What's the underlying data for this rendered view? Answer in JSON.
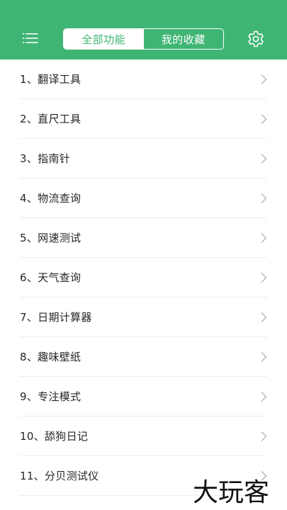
{
  "header": {
    "background": "#3fb574",
    "menu_icon": "list-menu-icon",
    "settings_icon": "gear-icon",
    "tabs": [
      {
        "label": "全部功能",
        "active": true
      },
      {
        "label": "我的收藏",
        "active": false
      }
    ]
  },
  "list": {
    "items": [
      {
        "label": "1、翻译工具"
      },
      {
        "label": "2、直尺工具"
      },
      {
        "label": "3、指南针"
      },
      {
        "label": "4、物流查询"
      },
      {
        "label": "5、网速测试"
      },
      {
        "label": "6、天气查询"
      },
      {
        "label": "7、日期计算器"
      },
      {
        "label": "8、趣味壁纸"
      },
      {
        "label": "9、专注模式"
      },
      {
        "label": "10、舔狗日记"
      },
      {
        "label": "11、分贝测试仪"
      }
    ],
    "chevron_icon": "chevron-right-icon"
  },
  "watermark": {
    "text": "大玩客"
  }
}
